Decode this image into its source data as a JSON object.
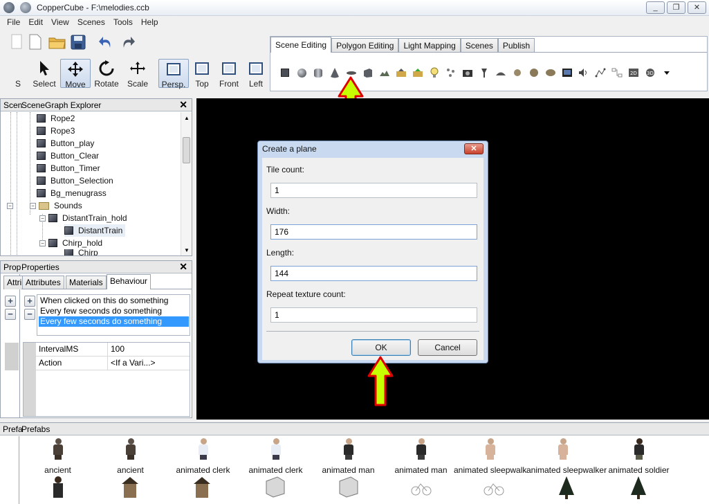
{
  "window": {
    "title": "CopperCube - F:\\melodies.ccb",
    "buttons": [
      "_",
      "❐",
      "✕"
    ]
  },
  "menu": [
    "File",
    "Edit",
    "View",
    "Scenes",
    "Tools",
    "Help"
  ],
  "toolbar": {
    "tools": [
      {
        "label": "S",
        "icon": "new-scene-icon"
      },
      {
        "label": "Select",
        "icon": "cursor-icon"
      },
      {
        "label": "Move",
        "icon": "move-icon",
        "active": true
      },
      {
        "label": "Rotate",
        "icon": "rotate-icon"
      },
      {
        "label": "Scale",
        "icon": "scale-icon"
      },
      {
        "label": "Persp.",
        "icon": "perspective-icon",
        "active": true
      },
      {
        "label": "Top",
        "icon": "top-view-icon"
      },
      {
        "label": "Front",
        "icon": "front-view-icon"
      },
      {
        "label": "Left",
        "icon": "left-view-icon"
      }
    ]
  },
  "scene_tabs": [
    "Scene Editing",
    "Polygon Editing",
    "Light Mapping",
    "Scenes",
    "Publish"
  ],
  "scene_shapes": [
    "cube",
    "sphere",
    "cylinder",
    "cone",
    "plane",
    "wall",
    "terrain",
    "import",
    "export",
    "light",
    "particles",
    "camera",
    "billboard",
    "water",
    "rock",
    "tree",
    "foliage",
    "skybox",
    "sound",
    "path",
    "hierarchy",
    "2d",
    "3d",
    "more"
  ],
  "scenegraph": {
    "title_prefix": "Scen",
    "title": "SceneGraph Explorer",
    "items": [
      {
        "label": "Rope2",
        "type": "node"
      },
      {
        "label": "Rope3",
        "type": "node"
      },
      {
        "label": "Button_play",
        "type": "node"
      },
      {
        "label": "Button_Clear",
        "type": "node"
      },
      {
        "label": "Button_Timer",
        "type": "node"
      },
      {
        "label": "Button_Selection",
        "type": "node"
      },
      {
        "label": "Bg_menugrass",
        "type": "node"
      },
      {
        "label": "Sounds",
        "type": "folder"
      },
      {
        "label": "DistantTrain_hold",
        "type": "node"
      },
      {
        "label": "DistantTrain",
        "type": "node"
      },
      {
        "label": "Chirp_hold",
        "type": "node"
      },
      {
        "label": "Chirp",
        "type": "node"
      }
    ]
  },
  "properties": {
    "title_prefix": "Prop",
    "title": "Properties",
    "tabs": [
      "Attri",
      "Attributes",
      "Materials",
      "Behaviour"
    ],
    "behaviours": [
      "When clicked on this do something",
      "Every few seconds do something",
      "Every few seconds do something"
    ],
    "fields": [
      {
        "name": "IntervalMS",
        "value": "100"
      },
      {
        "name": "Action",
        "value": "<If a Vari...>"
      }
    ]
  },
  "dialog": {
    "title": "Create a plane",
    "close": "✕",
    "fields": [
      {
        "label": "Tile count:",
        "value": "1"
      },
      {
        "label": "Width:",
        "value": "176"
      },
      {
        "label": "Length:",
        "value": "144"
      },
      {
        "label": "Repeat texture count:",
        "value": "1"
      }
    ],
    "ok": "OK",
    "cancel": "Cancel"
  },
  "prefabs": {
    "title_prefix": "Prefa",
    "title": "Prefabs",
    "row1": [
      "ancient",
      "ancient",
      "animated clerk",
      "animated clerk",
      "animated man",
      "animated man",
      "animated sleepwalk",
      "animated sleepwalker",
      "animated soldier"
    ]
  },
  "colors": {
    "arrow_fill": "#c8ff00",
    "arrow_stroke": "#e00000",
    "selection": "#3399ff"
  }
}
